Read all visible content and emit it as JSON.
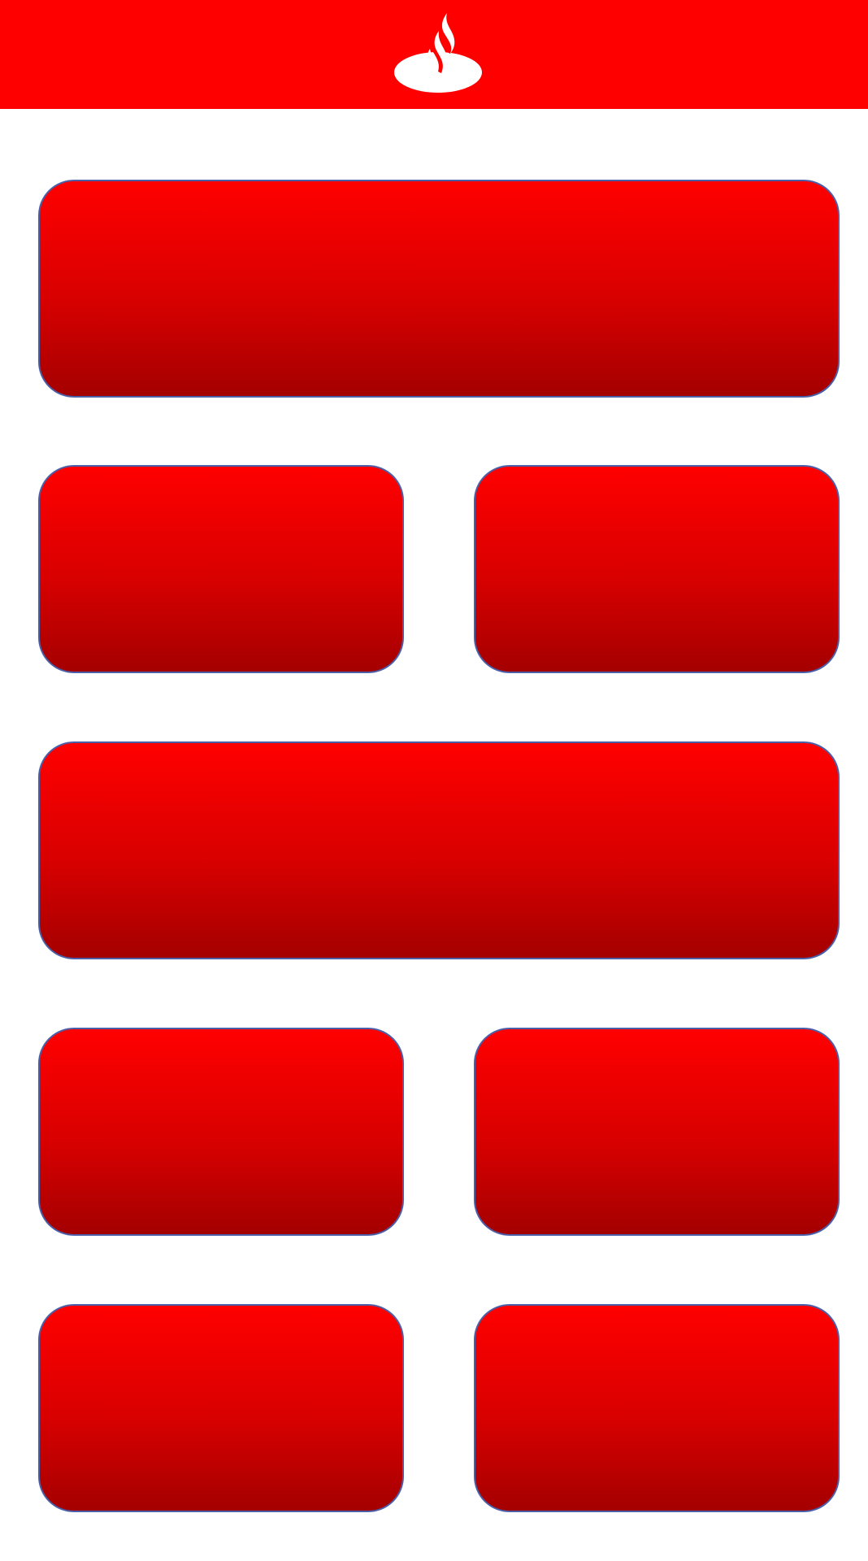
{
  "header": {
    "brand_color": "#ff0000",
    "logo_icon": "flame-logo-icon"
  },
  "tiles": {
    "accent_top": "#ff0000",
    "accent_bottom": "#a40000",
    "border_color": "#4a5fa8",
    "count": 8
  }
}
